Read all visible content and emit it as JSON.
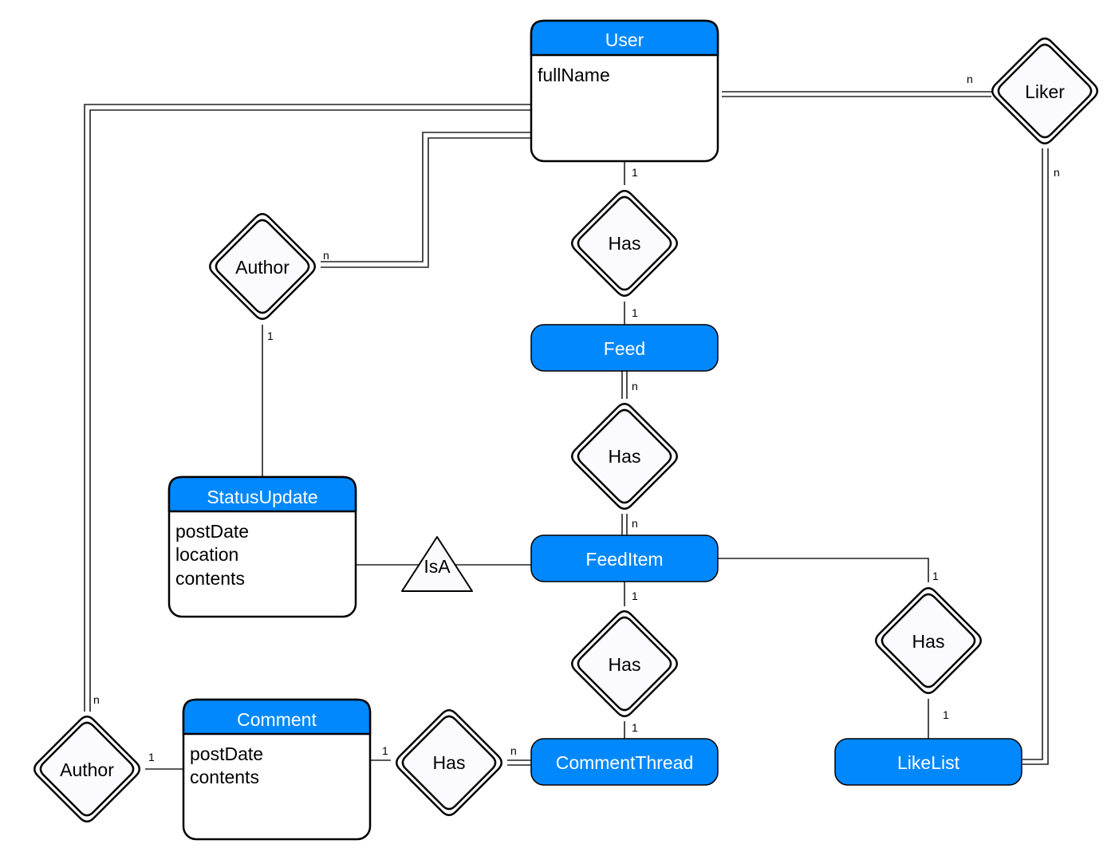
{
  "colors": {
    "entity_header": "#0088fc",
    "relationship_fill": "#fafaff",
    "stroke": "#000000"
  },
  "entities": {
    "user": {
      "name": "User",
      "attributes": [
        "fullName"
      ]
    },
    "feed": {
      "name": "Feed"
    },
    "feeditem": {
      "name": "FeedItem"
    },
    "statusupdate": {
      "name": "StatusUpdate",
      "attributes": [
        "postDate",
        "location",
        "contents"
      ]
    },
    "comment": {
      "name": "Comment",
      "attributes": [
        "postDate",
        "contents"
      ]
    },
    "commentthread": {
      "name": "CommentThread"
    },
    "likelist": {
      "name": "LikeList"
    }
  },
  "relationships": {
    "user_has_feed": "Has",
    "feed_has_feeditem": "Has",
    "feeditem_has_thread": "Has",
    "thread_has_comment": "Has",
    "feeditem_has_likelist": "Has",
    "author_status": "Author",
    "author_comment": "Author",
    "liker": "Liker",
    "isa": "IsA"
  },
  "cardinalities": {
    "user_has": "1",
    "has_feed": "1",
    "feed_has": "n",
    "has_feeditem": "n",
    "feeditem_has": "1",
    "has_thread": "1",
    "thread_has": "n",
    "has_comment": "1",
    "comment_author": "1",
    "author_user_bottom": "n",
    "author_user_top": "n",
    "author_status": "1",
    "user_liker": "n",
    "liker_likelist": "n",
    "feeditem_has_ll": "1",
    "has_likelist": "1"
  }
}
